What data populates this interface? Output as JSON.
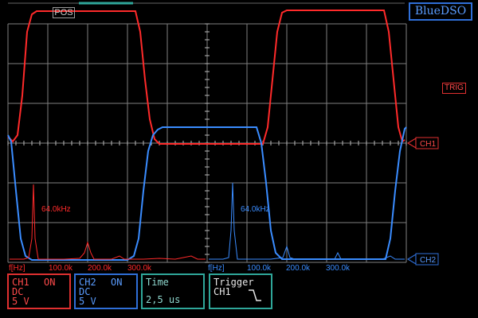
{
  "app": {
    "title": "BlueDSO"
  },
  "top": {
    "pos_label": "POS"
  },
  "markers": {
    "trig": "TRIG",
    "ch1": "CH1",
    "ch2": "CH2"
  },
  "colors": {
    "ch1": "#ff2a2a",
    "ch2": "#3a8cff",
    "grid": "#8a8a8a",
    "teal": "#2fa79a",
    "background": "#000000"
  },
  "fft": {
    "unit_label": "f[Hz]",
    "ticks": [
      "100.0k",
      "200.0k",
      "300.0k"
    ],
    "ch1_peak_label": "64.0kHz",
    "ch2_peak_label": "64.0kHz"
  },
  "panels": {
    "ch1": {
      "title": "CH1",
      "state": "ON",
      "coupling": "DC",
      "scale": "5 V"
    },
    "ch2": {
      "title": "CH2",
      "state": "ON",
      "coupling": "DC",
      "scale": "5 V"
    },
    "time": {
      "title": "Time",
      "value": "2,5 us"
    },
    "trigger": {
      "title": "Trigger",
      "source": "CH1",
      "edge_icon": "falling-edge-icon"
    }
  }
}
